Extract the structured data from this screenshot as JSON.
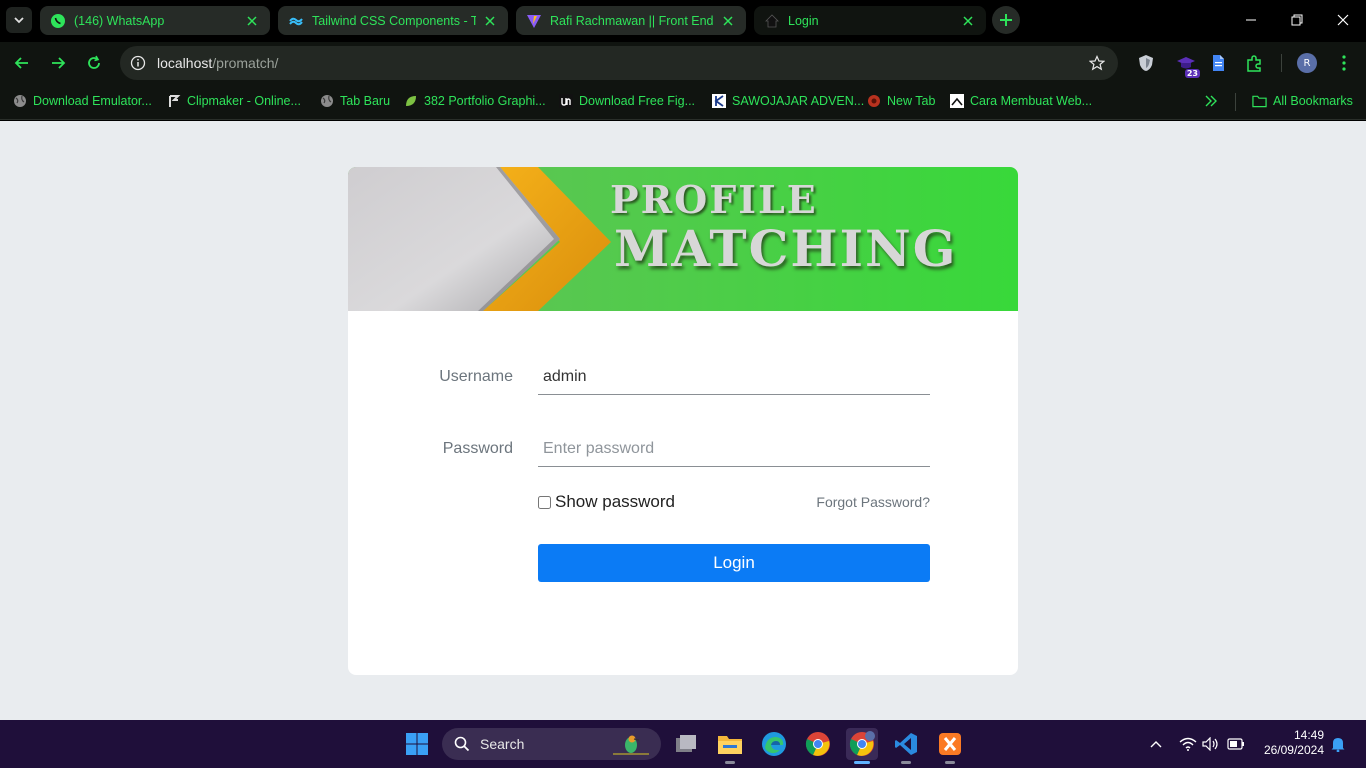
{
  "browser": {
    "tabs": [
      {
        "title": "(146) WhatsApp",
        "icon": "whatsapp-icon",
        "active": false
      },
      {
        "title": "Tailwind CSS Components - Tail",
        "icon": "tailwind-icon",
        "active": false
      },
      {
        "title": "Rafi Rachmawan || Front End De",
        "icon": "vite-icon",
        "active": false
      },
      {
        "title": "Login",
        "icon": "home-icon",
        "active": true
      }
    ],
    "address": {
      "host": "localhost",
      "path": "/promatch/"
    },
    "extension_badge": "23",
    "profile_initial": "R",
    "accent_color": "#2ee35a"
  },
  "bookmarks": {
    "items": [
      {
        "label": "Download Emulator...",
        "icon": "globe-icon"
      },
      {
        "label": "Clipmaker - Online...",
        "icon": "clipmaker-icon"
      },
      {
        "label": "Tab Baru",
        "icon": "globe-icon"
      },
      {
        "label": "382 Portfolio Graphi...",
        "icon": "leaf-icon"
      },
      {
        "label": "Download Free Fig...",
        "icon": "unsplash-icon"
      },
      {
        "label": "SAWOJAJAR ADVEN...",
        "icon": "k-icon"
      },
      {
        "label": "New Tab",
        "icon": "red-icon"
      },
      {
        "label": "Cara Membuat Web...",
        "icon": "document-icon"
      }
    ],
    "all_label": "All Bookmarks"
  },
  "login": {
    "banner_line1": "PROFILE",
    "banner_line2": "MATCHING",
    "username_label": "Username",
    "username_value": "admin",
    "password_label": "Password",
    "password_placeholder": "Enter password",
    "show_password_label": "Show password",
    "forgot_label": "Forgot Password?",
    "login_button": "Login",
    "button_color": "#0b7bf5"
  },
  "taskbar": {
    "search_label": "Search",
    "time": "14:49",
    "date": "26/09/2024"
  }
}
